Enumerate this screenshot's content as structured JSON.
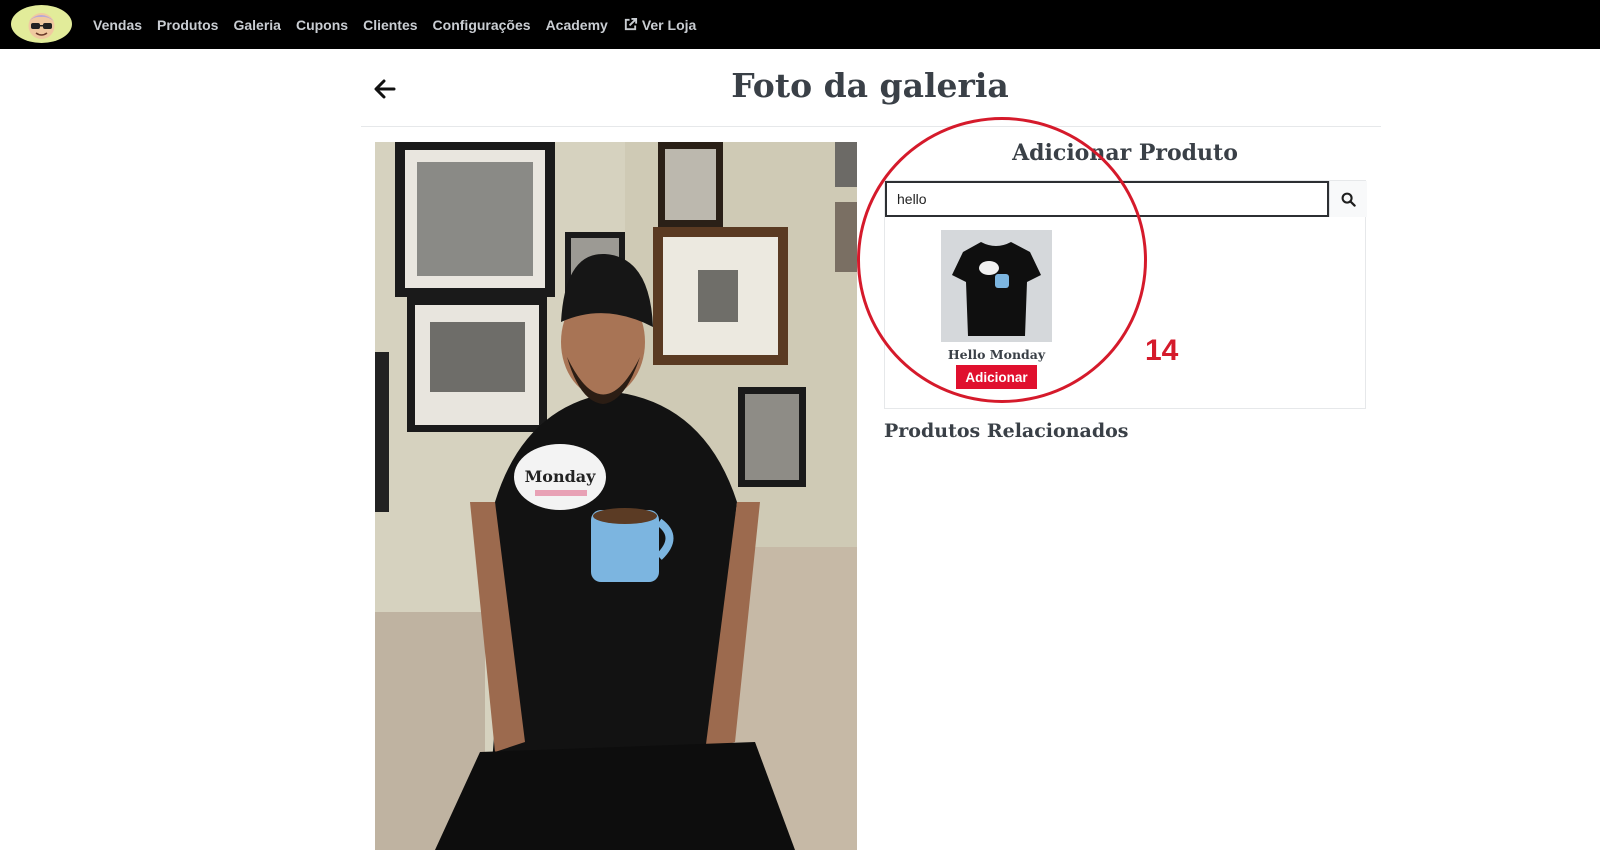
{
  "nav": {
    "items": [
      {
        "label": "Vendas"
      },
      {
        "label": "Produtos"
      },
      {
        "label": "Galeria"
      },
      {
        "label": "Cupons"
      },
      {
        "label": "Clientes"
      },
      {
        "label": "Configurações"
      },
      {
        "label": "Academy"
      },
      {
        "label": "Ver Loja",
        "icon": "external-link-icon"
      }
    ]
  },
  "header": {
    "title": "Foto da galeria",
    "back_icon": "arrow-left-icon"
  },
  "add_product": {
    "title": "Adicionar Produto",
    "search_value": "hello",
    "search_icon": "search-icon"
  },
  "results": [
    {
      "name": "Hello Monday",
      "button_label": "Adicionar",
      "button_color": "#e0102e"
    }
  ],
  "related": {
    "title": "Produtos Relacionados"
  },
  "annotation": {
    "number": "14",
    "color": "#d51a2b"
  }
}
